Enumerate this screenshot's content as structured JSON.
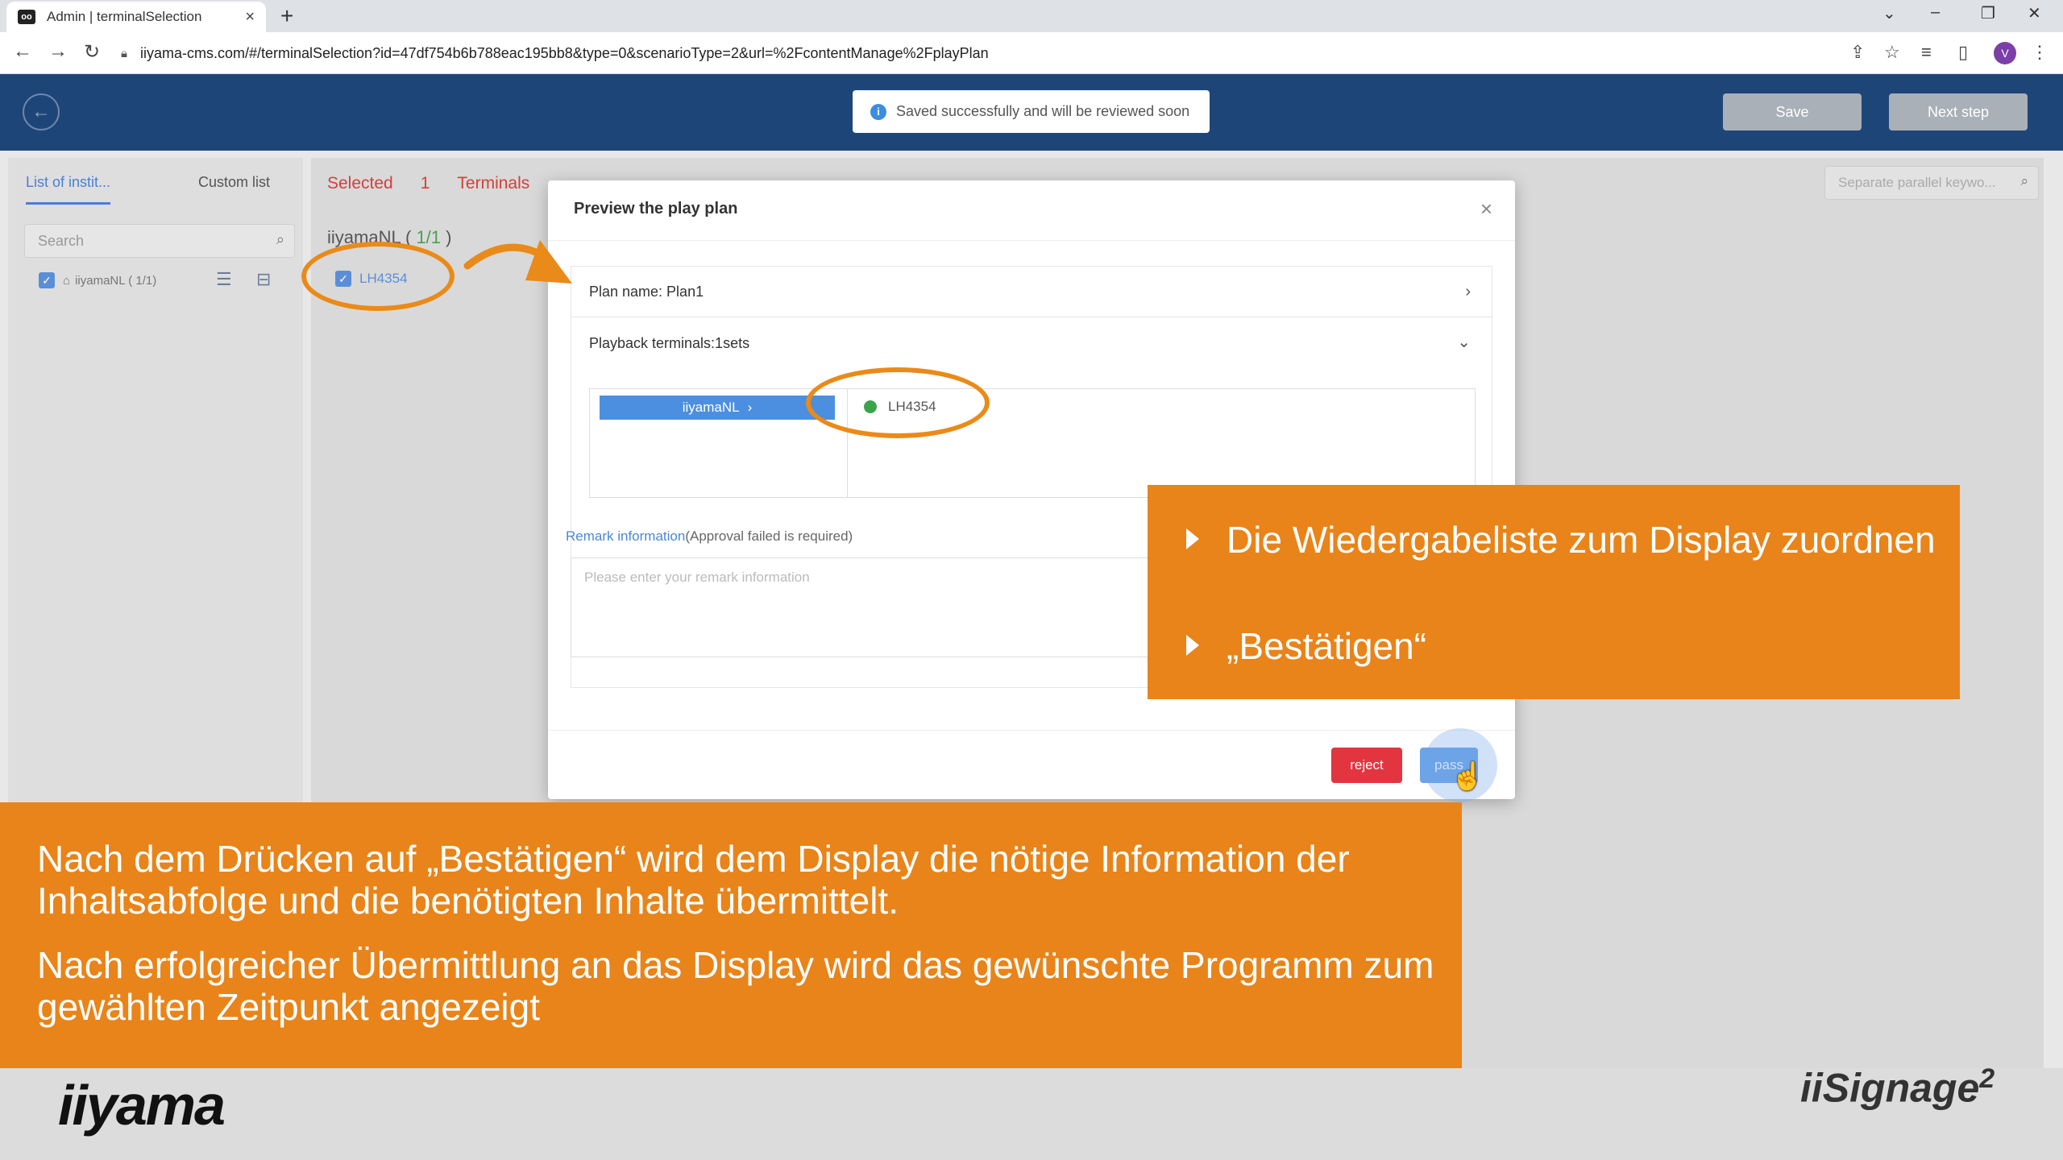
{
  "browser": {
    "tab_title": "Admin | terminalSelection",
    "tab_favicon": "oo",
    "url": "iiyama-cms.com/#/terminalSelection?id=47df754b6b788eac195bb8&type=0&scenarioType=2&url=%2FcontentManage%2FplayPlan",
    "profile_initial": "V"
  },
  "header": {
    "toast": "Saved successfully and will be reviewed soon",
    "save_label": "Save",
    "next_label": "Next step"
  },
  "left": {
    "tab1": "List of instit...",
    "tab2": "Custom list",
    "search_placeholder": "Search",
    "tree_item": "iiyamaNL ( 1/1)"
  },
  "middle": {
    "selected_label": "Selected",
    "selected_count": "1",
    "terminals_label": "Terminals",
    "group_name": "iiyamaNL (",
    "group_count": " 1/1 ",
    "group_close": ")",
    "terminal": "LH4354",
    "right_search_placeholder": "Separate parallel keywo..."
  },
  "modal": {
    "title": "Preview the play plan",
    "plan_name": "Plan name: Plan1",
    "playback": "Playback terminals:1sets",
    "group_button": "iiyamaNL",
    "terminal": "LH4354",
    "remark_link": "Remark information",
    "remark_suffix": "(Approval failed is required)",
    "remark_placeholder": "Please enter your remark information",
    "reject_label": "reject",
    "pass_label": "pass"
  },
  "overlay": {
    "bullets": [
      "Die Wiedergabeliste zum Display zuordnen",
      "„Bestätigen“"
    ],
    "caption1": "Nach dem Drücken auf „Bestätigen“ wird dem Display die nötige Information der Inhaltsabfolge und die benötigten Inhalte übermittelt.",
    "caption2": "Nach erfolgreicher Übermittlung an das Display wird das gewünschte Programm zum gewählten Zeitpunkt angezeigt"
  },
  "logos": {
    "left": "iiyama",
    "right": "iiSignage",
    "right_sup": "2"
  },
  "colors": {
    "header_blue": "#1e4577",
    "accent_orange": "#e8841a",
    "reject_red": "#e2353f",
    "primary_blue": "#4c8fe0"
  }
}
